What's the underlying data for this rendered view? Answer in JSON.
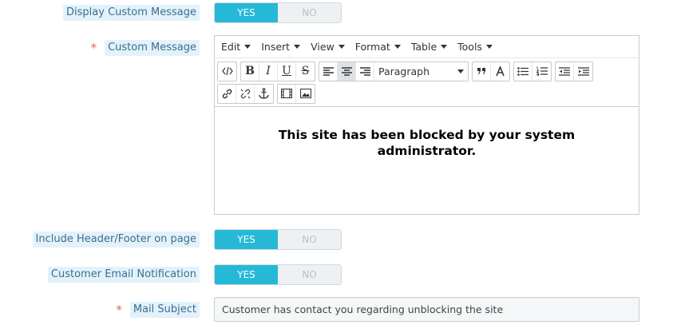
{
  "form": {
    "display_custom_message": {
      "label": "Display Custom Message",
      "yes": "YES",
      "no": "NO",
      "value": "YES"
    },
    "custom_message": {
      "label": "Custom Message",
      "required_mark": "*",
      "menubar": [
        "Edit",
        "Insert",
        "View",
        "Format",
        "Table",
        "Tools"
      ],
      "toolbar": {
        "format_select": "Paragraph",
        "bold": "B",
        "italic": "I",
        "underline": "U",
        "strike": "S",
        "source_code_icon": "code-icon",
        "align_left_icon": "align-left-icon",
        "align_center_icon": "align-center-icon",
        "align_right_icon": "align-right-icon",
        "blockquote_icon": "blockquote-icon",
        "text_color_icon": "text-color-icon",
        "bullet_list_icon": "bullet-list-icon",
        "numbered_list_icon": "numbered-list-icon",
        "outdent_icon": "outdent-icon",
        "indent_icon": "indent-icon",
        "link_icon": "link-icon",
        "unlink_icon": "unlink-icon",
        "anchor_icon": "anchor-icon",
        "media_icon": "media-icon",
        "image_icon": "image-icon"
      },
      "content": "This site has been blocked by your system administrator."
    },
    "include_header_footer": {
      "label": "Include Header/Footer on page",
      "yes": "YES",
      "no": "NO",
      "value": "YES"
    },
    "customer_email_notification": {
      "label": "Customer Email Notification",
      "yes": "YES",
      "no": "NO",
      "value": "YES"
    },
    "mail_subject": {
      "label": "Mail Subject",
      "required_mark": "*",
      "value": "Customer has contact you regarding unblocking the site"
    }
  },
  "colors": {
    "accent": "#25b9d7",
    "label_bg": "#e3f2fa",
    "label_text": "#3b6e8f",
    "required": "#e0625b"
  }
}
